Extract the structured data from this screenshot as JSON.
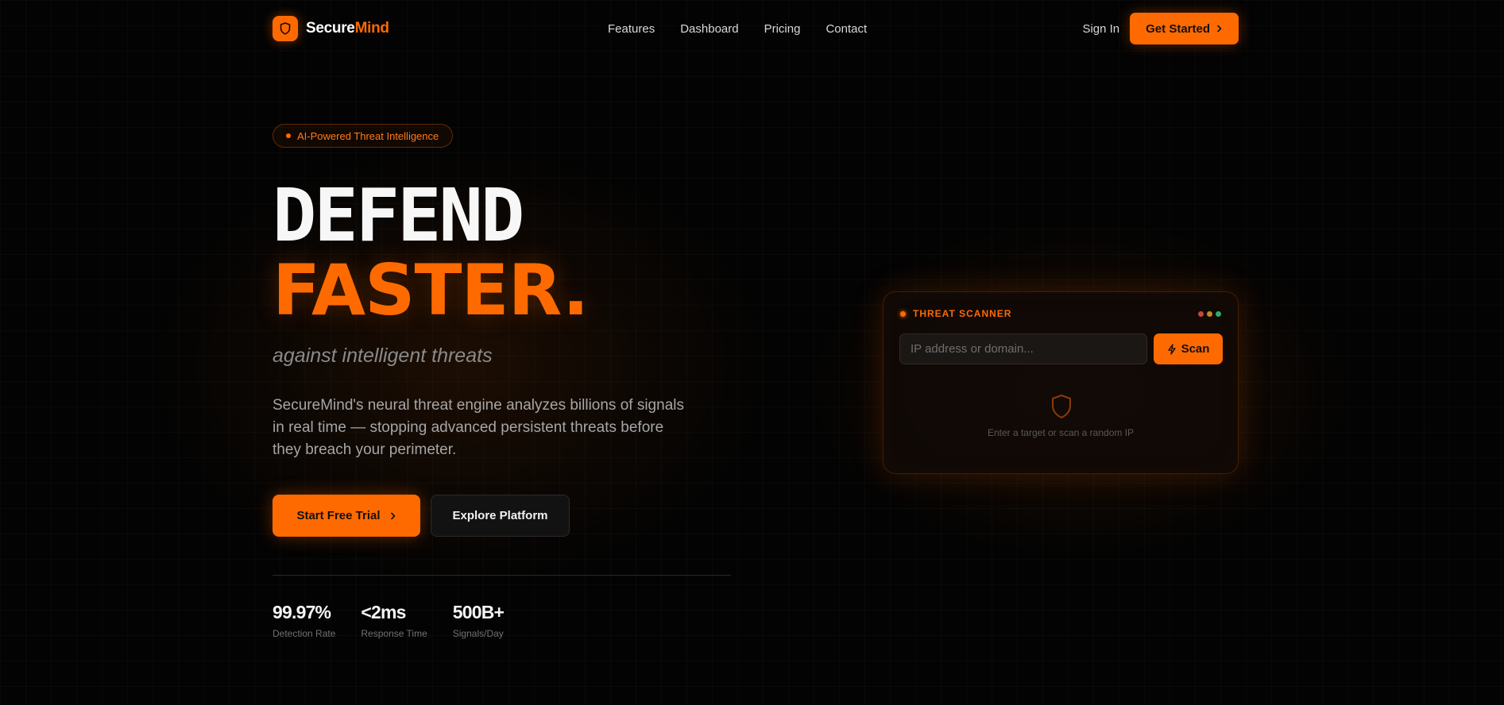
{
  "brand": {
    "name_part1": "Secure",
    "name_part2": "Mind"
  },
  "nav": {
    "links": [
      "Features",
      "Dashboard",
      "Pricing",
      "Contact"
    ],
    "sign_in": "Sign In",
    "get_started": "Get Started"
  },
  "hero": {
    "badge": "AI-Powered Threat Intelligence",
    "headline_line1": "DEFEND",
    "headline_line2": "FASTER.",
    "tagline": "against intelligent threats",
    "description": "SecureMind's neural threat engine analyzes billions of signals in real time — stopping advanced persistent threats before they breach your perimeter.",
    "cta_primary": "Start Free Trial",
    "cta_secondary": "Explore Platform"
  },
  "stats": [
    {
      "value": "99.97%",
      "label": "Detection Rate"
    },
    {
      "value": "<2ms",
      "label": "Response Time"
    },
    {
      "value": "500B+",
      "label": "Signals/Day"
    }
  ],
  "scanner": {
    "title": "THREAT SCANNER",
    "input_placeholder": "IP address or domain...",
    "scan_button": "Scan",
    "empty_state": "Enter a target or scan a random IP",
    "window_lights": [
      "#c8463b",
      "#c28a1e",
      "#2faa6a"
    ]
  },
  "colors": {
    "accent": "#ff6a00",
    "background": "#030303"
  },
  "icons": {
    "logo": "shield-icon",
    "get_started": "chevron-right-icon",
    "cta_primary": "chevron-right-icon",
    "scan": "lightning-icon",
    "empty_state": "shield-icon"
  }
}
